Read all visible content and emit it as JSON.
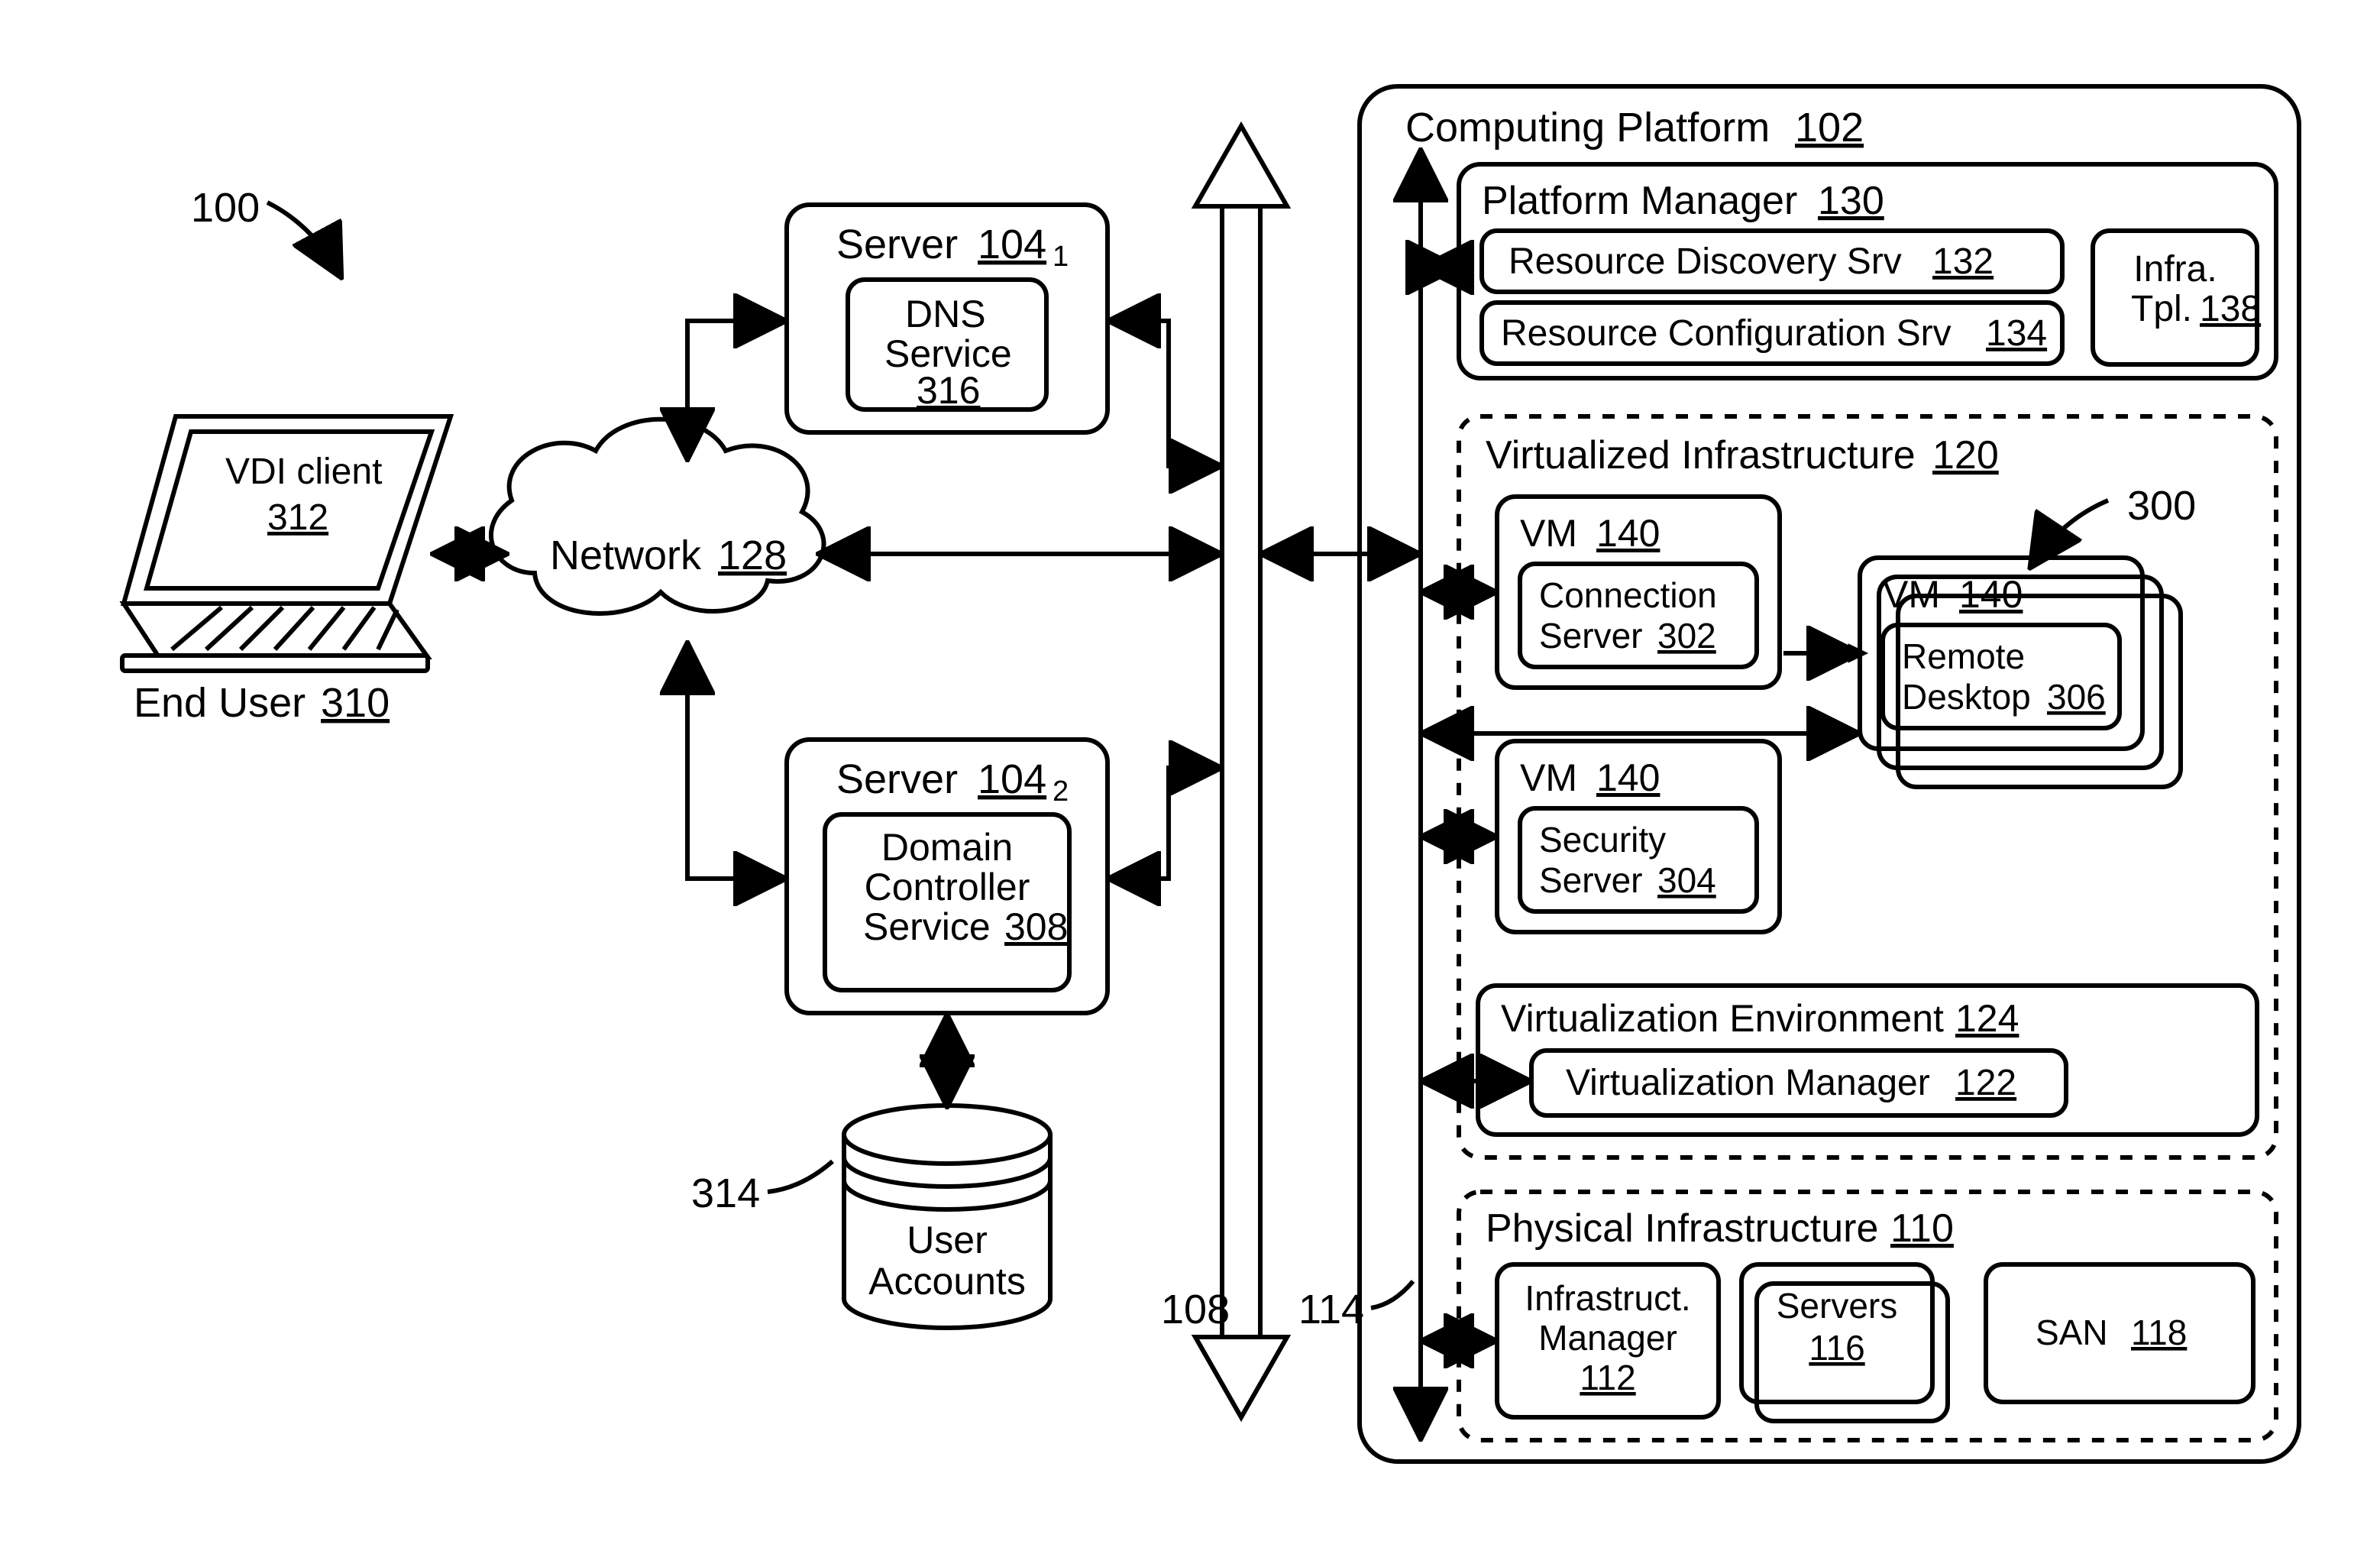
{
  "refs": {
    "system": "100",
    "leftBus": "108",
    "rightBus": "114",
    "userAccounts": "314",
    "vdiGroup": "300"
  },
  "endUser": {
    "label": "End User",
    "ref": "310",
    "client": {
      "label": "VDI client",
      "ref": "312"
    }
  },
  "network": {
    "label": "Network",
    "ref": "128"
  },
  "server1": {
    "label": "Server",
    "ref": "104",
    "sub": "1",
    "dns": {
      "line1": "DNS",
      "line2": "Service",
      "ref": "316"
    }
  },
  "server2": {
    "label": "Server",
    "ref": "104",
    "sub": "2",
    "dc": {
      "line1": "Domain",
      "line2": "Controller",
      "line3": "Service",
      "ref": "308"
    }
  },
  "userAccounts": {
    "line1": "User",
    "line2": "Accounts"
  },
  "platform": {
    "label": "Computing Platform",
    "ref": "102",
    "pm": {
      "label": "Platform Manager",
      "ref": "130",
      "rds": {
        "label": "Resource Discovery Srv",
        "ref": "132"
      },
      "rcs": {
        "label": "Resource Configuration Srv",
        "ref": "134"
      },
      "tpl": {
        "line1": "Infra.",
        "line2": "Tpl.",
        "ref": "138"
      }
    },
    "vi": {
      "label": "Virtualized Infrastructure",
      "ref": "120",
      "vmConn": {
        "label": "VM",
        "ref": "140",
        "inner1": "Connection",
        "inner2": "Server",
        "innerRef": "302"
      },
      "vmSec": {
        "label": "VM",
        "ref": "140",
        "inner1": "Security",
        "inner2": "Server",
        "innerRef": "304"
      },
      "vmRD": {
        "label": "VM",
        "ref": "140",
        "inner1": "Remote",
        "inner2": "Desktop",
        "innerRef": "306"
      },
      "env": {
        "label": "Virtualization Environment",
        "ref": "124",
        "mgr": {
          "label": "Virtualization Manager",
          "ref": "122"
        }
      }
    },
    "pi": {
      "label": "Physical Infrastructure",
      "ref": "110",
      "im": {
        "line1": "Infrastruct.",
        "line2": "Manager",
        "ref": "112"
      },
      "srv": {
        "label": "Servers",
        "ref": "116"
      },
      "san": {
        "label": "SAN",
        "ref": "118"
      }
    }
  }
}
